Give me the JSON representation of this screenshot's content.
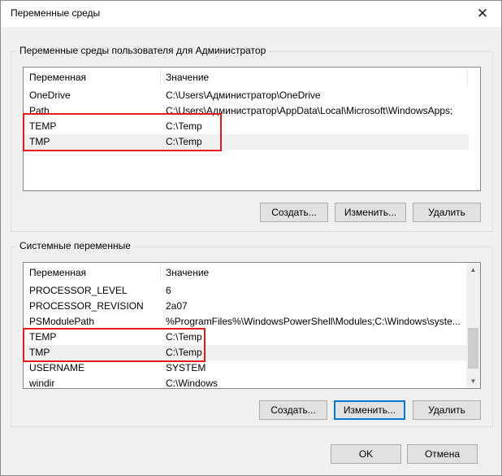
{
  "window": {
    "title": "Переменные среды",
    "close_glyph": "✕"
  },
  "user_group": {
    "label": "Переменные среды пользователя для Администратор",
    "columns": {
      "name": "Переменная",
      "value": "Значение"
    },
    "rows": [
      {
        "name": "OneDrive",
        "value": "C:\\Users\\Администратор\\OneDrive"
      },
      {
        "name": "Path",
        "value": "C:\\Users\\Администратор\\AppData\\Local\\Microsoft\\WindowsApps;"
      },
      {
        "name": "TEMP",
        "value": "C:\\Temp"
      },
      {
        "name": "TMP",
        "value": "C:\\Temp"
      }
    ],
    "buttons": {
      "create": "Создать...",
      "edit": "Изменить...",
      "delete": "Удалить"
    }
  },
  "system_group": {
    "label": "Системные переменные",
    "columns": {
      "name": "Переменная",
      "value": "Значение"
    },
    "rows": [
      {
        "name": "PROCESSOR_LEVEL",
        "value": "6"
      },
      {
        "name": "PROCESSOR_REVISION",
        "value": "2a07"
      },
      {
        "name": "PSModulePath",
        "value": "%ProgramFiles%\\WindowsPowerShell\\Modules;C:\\Windows\\syste..."
      },
      {
        "name": "TEMP",
        "value": "C:\\Temp"
      },
      {
        "name": "TMP",
        "value": "C:\\Temp"
      },
      {
        "name": "USERNAME",
        "value": "SYSTEM"
      },
      {
        "name": "windir",
        "value": "C:\\Windows"
      }
    ],
    "buttons": {
      "create": "Создать...",
      "edit": "Изменить...",
      "delete": "Удалить"
    }
  },
  "footer": {
    "ok": "OK",
    "cancel": "Отмена"
  },
  "colors": {
    "highlight": "#e01d1d",
    "focus_border": "#0078d7"
  }
}
